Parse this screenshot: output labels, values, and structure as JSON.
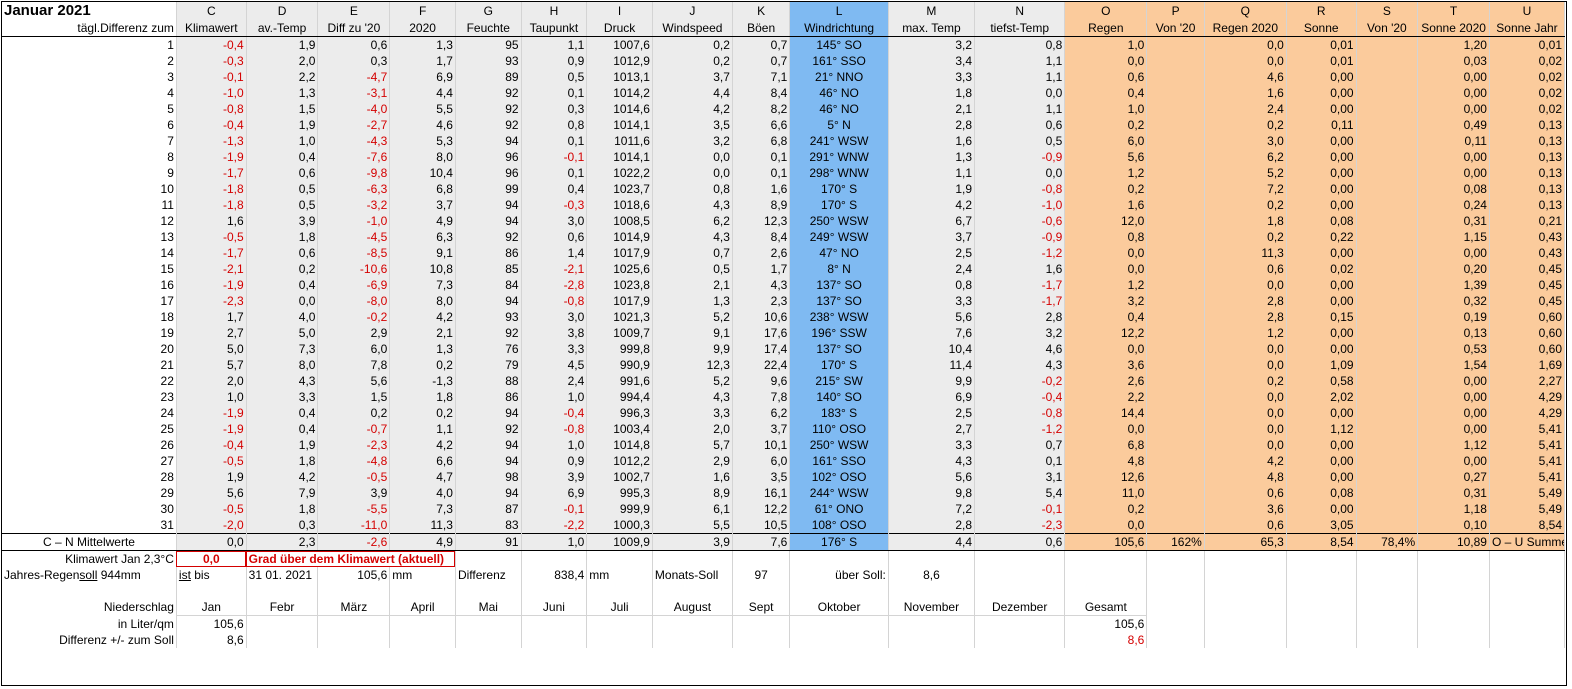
{
  "title": "Januar 2021",
  "col_letters": [
    "C",
    "D",
    "E",
    "F",
    "G",
    "H",
    "I",
    "J",
    "K",
    "L",
    "M",
    "N",
    "O",
    "P",
    "Q",
    "R",
    "S",
    "T",
    "U"
  ],
  "col_headers": [
    "Klimawert",
    "av.-Temp",
    "Diff zu '20",
    "2020",
    "Feuchte",
    "Taupunkt",
    "Druck",
    "Windspeed",
    "Böen",
    "Windrichtung",
    "max. Temp",
    "tiefst-Temp",
    "Regen",
    "Von '20",
    "Regen 2020",
    "Sonne",
    "Von '20",
    "Sonne 2020",
    "Sonne Jahr"
  ],
  "row_label_header": "tägl.Differenz zum",
  "rows": [
    [
      "1",
      "-0,4",
      "1,9",
      "0,6",
      "1,3",
      "95",
      "1,1",
      "1007,6",
      "0,2",
      "0,7",
      "145° SO",
      "3,2",
      "0,8",
      "1,0",
      "",
      "0,0",
      "0,01",
      "",
      "1,20",
      "0,01"
    ],
    [
      "2",
      "-0,3",
      "2,0",
      "0,3",
      "1,7",
      "93",
      "0,9",
      "1012,9",
      "0,2",
      "0,7",
      "161° SSO",
      "3,4",
      "1,1",
      "0,0",
      "",
      "0,0",
      "0,01",
      "",
      "0,03",
      "0,02"
    ],
    [
      "3",
      "-0,1",
      "2,2",
      "-4,7",
      "6,9",
      "89",
      "0,5",
      "1013,1",
      "3,7",
      "7,1",
      "21° NNO",
      "3,3",
      "1,1",
      "0,6",
      "",
      "4,6",
      "0,00",
      "",
      "0,00",
      "0,02"
    ],
    [
      "4",
      "-1,0",
      "1,3",
      "-3,1",
      "4,4",
      "92",
      "0,1",
      "1014,2",
      "4,4",
      "8,4",
      "46° NO",
      "1,8",
      "0,0",
      "0,4",
      "",
      "1,6",
      "0,00",
      "",
      "0,00",
      "0,02"
    ],
    [
      "5",
      "-0,8",
      "1,5",
      "-4,0",
      "5,5",
      "92",
      "0,3",
      "1014,6",
      "4,2",
      "8,2",
      "46° NO",
      "2,1",
      "1,1",
      "1,0",
      "",
      "2,4",
      "0,00",
      "",
      "0,00",
      "0,02"
    ],
    [
      "6",
      "-0,4",
      "1,9",
      "-2,7",
      "4,6",
      "92",
      "0,8",
      "1014,1",
      "3,5",
      "6,6",
      "5° N",
      "2,8",
      "0,6",
      "0,2",
      "",
      "0,2",
      "0,11",
      "",
      "0,49",
      "0,13"
    ],
    [
      "7",
      "-1,3",
      "1,0",
      "-4,3",
      "5,3",
      "94",
      "0,1",
      "1011,6",
      "3,2",
      "6,8",
      "241° WSW",
      "1,6",
      "0,5",
      "6,0",
      "",
      "3,0",
      "0,00",
      "",
      "0,11",
      "0,13"
    ],
    [
      "8",
      "-1,9",
      "0,4",
      "-7,6",
      "8,0",
      "96",
      "-0,1",
      "1014,1",
      "0,0",
      "0,1",
      "291° WNW",
      "1,3",
      "-0,9",
      "5,6",
      "",
      "6,2",
      "0,00",
      "",
      "0,00",
      "0,13"
    ],
    [
      "9",
      "-1,7",
      "0,6",
      "-9,8",
      "10,4",
      "96",
      "0,1",
      "1022,2",
      "0,0",
      "0,1",
      "298° WNW",
      "1,1",
      "0,0",
      "1,2",
      "",
      "5,2",
      "0,00",
      "",
      "0,00",
      "0,13"
    ],
    [
      "10",
      "-1,8",
      "0,5",
      "-6,3",
      "6,8",
      "99",
      "0,4",
      "1023,7",
      "0,8",
      "1,6",
      "170° S",
      "1,9",
      "-0,8",
      "0,2",
      "",
      "7,2",
      "0,00",
      "",
      "0,08",
      "0,13"
    ],
    [
      "11",
      "-1,8",
      "0,5",
      "-3,2",
      "3,7",
      "94",
      "-0,3",
      "1018,6",
      "4,3",
      "8,9",
      "170° S",
      "4,2",
      "-1,0",
      "1,6",
      "",
      "0,2",
      "0,00",
      "",
      "0,24",
      "0,13"
    ],
    [
      "12",
      "1,6",
      "3,9",
      "-1,0",
      "4,9",
      "94",
      "3,0",
      "1008,5",
      "6,2",
      "12,3",
      "250° WSW",
      "6,7",
      "-0,6",
      "12,0",
      "",
      "1,8",
      "0,08",
      "",
      "0,31",
      "0,21"
    ],
    [
      "13",
      "-0,5",
      "1,8",
      "-4,5",
      "6,3",
      "92",
      "0,6",
      "1014,9",
      "4,3",
      "8,4",
      "249° WSW",
      "3,7",
      "-0,9",
      "0,8",
      "",
      "0,2",
      "0,22",
      "",
      "1,15",
      "0,43"
    ],
    [
      "14",
      "-1,7",
      "0,6",
      "-8,5",
      "9,1",
      "86",
      "1,4",
      "1017,9",
      "0,7",
      "2,6",
      "47° NO",
      "2,5",
      "-1,2",
      "0,0",
      "",
      "11,3",
      "0,00",
      "",
      "0,00",
      "0,43"
    ],
    [
      "15",
      "-2,1",
      "0,2",
      "-10,6",
      "10,8",
      "85",
      "-2,1",
      "1025,6",
      "0,5",
      "1,7",
      "8° N",
      "2,4",
      "1,6",
      "0,0",
      "",
      "0,6",
      "0,02",
      "",
      "0,20",
      "0,45"
    ],
    [
      "16",
      "-1,9",
      "0,4",
      "-6,9",
      "7,3",
      "84",
      "-2,8",
      "1023,8",
      "2,1",
      "4,3",
      "137° SO",
      "0,8",
      "-1,7",
      "1,2",
      "",
      "0,0",
      "0,00",
      "",
      "1,39",
      "0,45"
    ],
    [
      "17",
      "-2,3",
      "0,0",
      "-8,0",
      "8,0",
      "94",
      "-0,8",
      "1017,9",
      "1,3",
      "2,3",
      "137° SO",
      "3,3",
      "-1,7",
      "3,2",
      "",
      "2,8",
      "0,00",
      "",
      "0,32",
      "0,45"
    ],
    [
      "18",
      "1,7",
      "4,0",
      "-0,2",
      "4,2",
      "93",
      "3,0",
      "1021,3",
      "5,2",
      "10,6",
      "238° WSW",
      "5,6",
      "2,8",
      "0,4",
      "",
      "2,8",
      "0,15",
      "",
      "0,19",
      "0,60"
    ],
    [
      "19",
      "2,7",
      "5,0",
      "2,9",
      "2,1",
      "92",
      "3,8",
      "1009,7",
      "9,1",
      "17,6",
      "196° SSW",
      "7,6",
      "3,2",
      "12,2",
      "",
      "1,2",
      "0,00",
      "",
      "0,13",
      "0,60"
    ],
    [
      "20",
      "5,0",
      "7,3",
      "6,0",
      "1,3",
      "76",
      "3,3",
      "999,8",
      "9,9",
      "17,4",
      "137° SO",
      "10,4",
      "4,6",
      "0,0",
      "",
      "0,0",
      "0,00",
      "",
      "0,53",
      "0,60"
    ],
    [
      "21",
      "5,7",
      "8,0",
      "7,8",
      "0,2",
      "79",
      "4,5",
      "990,9",
      "12,3",
      "22,4",
      "170° S",
      "11,4",
      "4,3",
      "3,6",
      "",
      "0,0",
      "1,09",
      "",
      "1,54",
      "1,69"
    ],
    [
      "22",
      "2,0",
      "4,3",
      "5,6",
      "-1,3",
      "88",
      "2,4",
      "991,6",
      "5,2",
      "9,6",
      "215° SW",
      "9,9",
      "-0,2",
      "2,6",
      "",
      "0,2",
      "0,58",
      "",
      "0,00",
      "2,27"
    ],
    [
      "23",
      "1,0",
      "3,3",
      "1,5",
      "1,8",
      "86",
      "1,0",
      "994,4",
      "4,3",
      "7,8",
      "140° SO",
      "6,9",
      "-0,4",
      "2,2",
      "",
      "0,0",
      "2,02",
      "",
      "0,00",
      "4,29"
    ],
    [
      "24",
      "-1,9",
      "0,4",
      "0,2",
      "0,2",
      "94",
      "-0,4",
      "996,3",
      "3,3",
      "6,2",
      "183° S",
      "2,5",
      "-0,8",
      "14,4",
      "",
      "0,0",
      "0,00",
      "",
      "0,00",
      "4,29"
    ],
    [
      "25",
      "-1,9",
      "0,4",
      "-0,7",
      "1,1",
      "92",
      "-0,8",
      "1003,4",
      "2,0",
      "3,7",
      "110° OSO",
      "2,7",
      "-1,2",
      "0,0",
      "",
      "0,0",
      "1,12",
      "",
      "0,00",
      "5,41"
    ],
    [
      "26",
      "-0,4",
      "1,9",
      "-2,3",
      "4,2",
      "94",
      "1,0",
      "1014,8",
      "5,7",
      "10,1",
      "250° WSW",
      "3,3",
      "0,7",
      "6,8",
      "",
      "0,0",
      "0,00",
      "",
      "1,12",
      "5,41"
    ],
    [
      "27",
      "-0,5",
      "1,8",
      "-4,8",
      "6,6",
      "94",
      "0,9",
      "1012,2",
      "2,9",
      "6,0",
      "161° SSO",
      "4,3",
      "0,1",
      "4,8",
      "",
      "4,2",
      "0,00",
      "",
      "0,00",
      "5,41"
    ],
    [
      "28",
      "1,9",
      "4,2",
      "-0,5",
      "4,7",
      "98",
      "3,9",
      "1002,7",
      "1,6",
      "3,5",
      "102° OSO",
      "5,6",
      "3,1",
      "12,6",
      "",
      "4,8",
      "0,00",
      "",
      "0,27",
      "5,41"
    ],
    [
      "29",
      "5,6",
      "7,9",
      "3,9",
      "4,0",
      "94",
      "6,9",
      "995,3",
      "8,9",
      "16,1",
      "244° WSW",
      "9,8",
      "5,4",
      "11,0",
      "",
      "0,6",
      "0,08",
      "",
      "0,31",
      "5,49"
    ],
    [
      "30",
      "-0,5",
      "1,8",
      "-5,5",
      "7,3",
      "87",
      "-0,1",
      "999,9",
      "6,1",
      "12,2",
      "61° ONO",
      "7,2",
      "-0,1",
      "0,2",
      "",
      "3,6",
      "0,00",
      "",
      "1,18",
      "5,49"
    ],
    [
      "31",
      "-2,0",
      "0,3",
      "-11,0",
      "11,3",
      "83",
      "-2,2",
      "1000,3",
      "5,5",
      "10,5",
      "108° OSO",
      "2,8",
      "-2,3",
      "0,0",
      "",
      "0,6",
      "3,05",
      "",
      "0,10",
      "8,54"
    ]
  ],
  "mean_row": {
    "label": "C – N Mittelwerte",
    "values": [
      "0,0",
      "2,3",
      "-2,6",
      "4,9",
      "91",
      "1,0",
      "1009,9",
      "3,9",
      "7,6",
      "176° S",
      "4,4",
      "0,6",
      "105,6",
      "162%",
      "65,3",
      "8,54",
      "78,4%",
      "10,89"
    ],
    "sum_label": "O – U Summen"
  },
  "klimawert": {
    "label": "Klimawert Jan 2,3°C",
    "value": "0,0",
    "note": "Grad über dem Klimawert (aktuell)"
  },
  "jahres": {
    "label_prefix": "Jahres-Regen",
    "label_ul": "soll",
    "label_suffix": " 944mm",
    "ist": "ist",
    "bis": " bis",
    "date": "31 01. 2021",
    "amount": "105,6",
    "unit1": "mm",
    "diff_label": "Differenz",
    "diff_value": "838,4",
    "unit2": "mm",
    "monats_label": "Monats-Soll",
    "monats_value": "97",
    "ueber_label": "über Soll:",
    "ueber_value": "8,6"
  },
  "niederschlag": {
    "label": "Niederschlag",
    "months": [
      "Jan",
      "Febr",
      "März",
      "April",
      "Mai",
      "Juni",
      "Juli",
      "August",
      "Sept",
      "Oktober",
      "November",
      "Dezember"
    ],
    "gesamt_label": "Gesamt",
    "liter_label": "in Liter/qm",
    "liter_jan": "105,6",
    "liter_gesamt": "105,6",
    "diff_label": "Differenz  +/- zum Soll",
    "diff_jan": "8,6",
    "diff_gesamt": "8,6"
  },
  "colors": {
    "gray_band": "#ececec",
    "blue_band": "#7fbaf2",
    "orange_band": "#fbcb9c",
    "negative": "#d40000"
  }
}
